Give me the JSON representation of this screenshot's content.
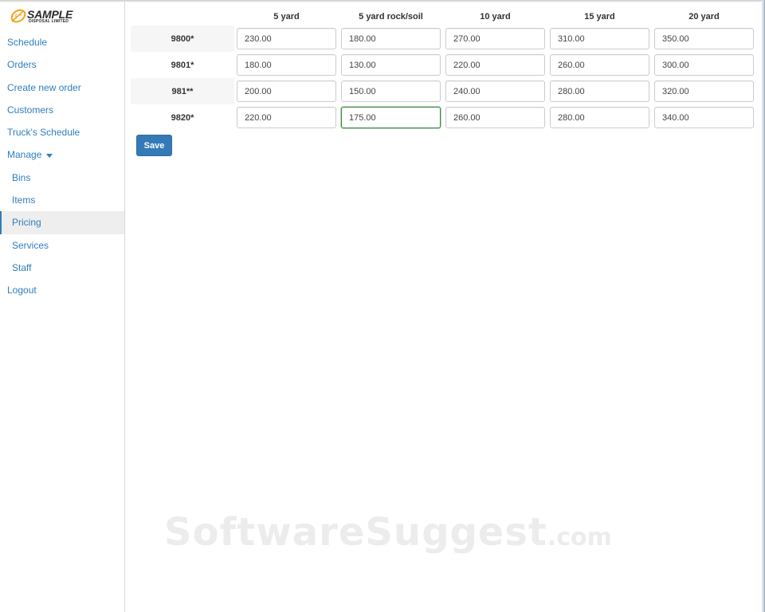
{
  "logo": {
    "name": "SAMPLE",
    "subtitle": "DISPOSAL LIMITED",
    "icon": "leaf-icon",
    "accent_color": "#f4a21a"
  },
  "sidebar": {
    "items": [
      {
        "label": "Schedule"
      },
      {
        "label": "Orders"
      },
      {
        "label": "Create new order"
      },
      {
        "label": "Customers"
      },
      {
        "label": "Truck's Schedule"
      },
      {
        "label": "Manage"
      },
      {
        "label": "Bins"
      },
      {
        "label": "Items"
      },
      {
        "label": "Pricing"
      },
      {
        "label": "Services"
      },
      {
        "label": "Staff"
      },
      {
        "label": "Logout"
      }
    ],
    "active": "Pricing",
    "link_color": "#2f7dbd"
  },
  "pricing": {
    "columns": [
      "5 yard",
      "5 yard rock/soil",
      "10 yard",
      "15 yard",
      "20 yard"
    ],
    "rows": [
      {
        "label": "9800*",
        "values": [
          "230.00",
          "180.00",
          "270.00",
          "310.00",
          "350.00"
        ]
      },
      {
        "label": "9801*",
        "values": [
          "180.00",
          "130.00",
          "220.00",
          "260.00",
          "300.00"
        ]
      },
      {
        "label": "981**",
        "values": [
          "200.00",
          "150.00",
          "240.00",
          "280.00",
          "320.00"
        ]
      },
      {
        "label": "9820*",
        "values": [
          "220.00",
          "175.00",
          "260.00",
          "280.00",
          "340.00"
        ]
      }
    ],
    "focused_cell": {
      "row": 3,
      "column": 1
    }
  },
  "actions": {
    "save_label": "Save",
    "save_color": "#337ab7"
  },
  "watermark": {
    "text": "SoftwareSuggest",
    "suffix": ".com"
  }
}
